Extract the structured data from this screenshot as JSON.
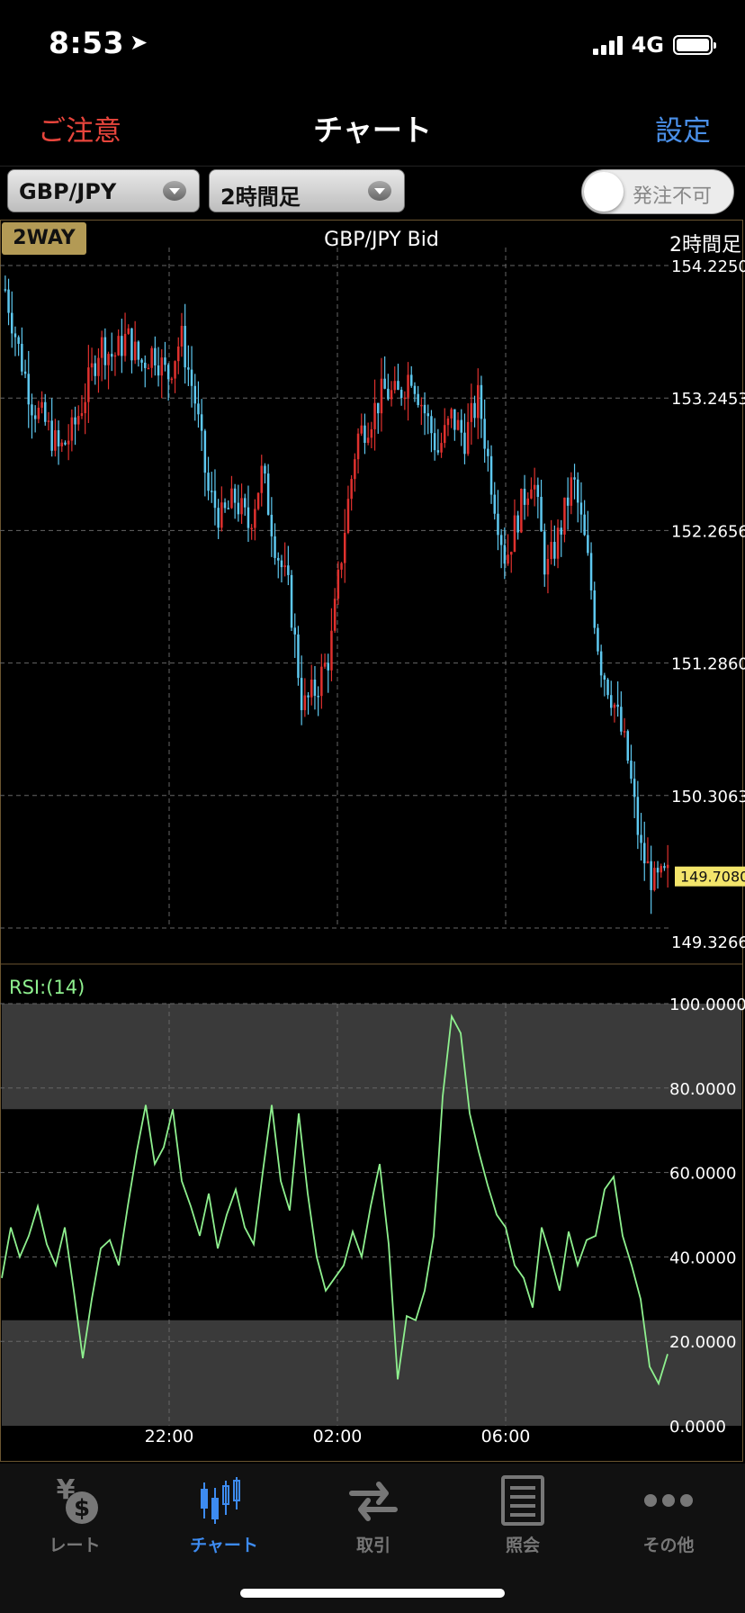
{
  "status": {
    "time": "8:53",
    "network": "4G"
  },
  "nav": {
    "caution": "ご注意",
    "title": "チャート",
    "settings": "設定"
  },
  "controls": {
    "pair": "GBP/JPY",
    "timeframe": "2時間足",
    "order_toggle": "発注不可"
  },
  "chart": {
    "mode_badge": "2WAY",
    "title": "GBP/JPY  Bid",
    "timeframe_label": "2時間足",
    "current_price": "149.7080",
    "rsi_label": "RSI:(14)",
    "colors": {
      "up": "#e0312e",
      "down": "#5ec8f0",
      "rsi": "#8ef08e",
      "price_tag": "#f3e56b",
      "panel_border": "#6b5530"
    }
  },
  "chart_data": [
    {
      "type": "candlestick",
      "title": "GBP/JPY  Bid",
      "price_ticks": [
        "154.2250",
        "153.2453",
        "152.2656",
        "151.2860",
        "150.3063",
        "149.3266"
      ],
      "x_ticks": [
        "22:00",
        "02:00",
        "06:00"
      ],
      "ylim": [
        149.3266,
        154.225
      ],
      "close_path": [
        154.05,
        153.6,
        153.2,
        153.05,
        152.85,
        153.0,
        153.3,
        153.65,
        153.55,
        153.7,
        153.5,
        153.6,
        153.4,
        153.7,
        153.25,
        152.55,
        152.35,
        152.5,
        152.3,
        152.7,
        152.15,
        151.8,
        150.95,
        151.1,
        151.35,
        152.2,
        152.95,
        153.1,
        153.3,
        153.25,
        153.45,
        153.15,
        152.85,
        153.1,
        152.95,
        153.25,
        152.6,
        152.05,
        152.4,
        152.7,
        151.95,
        152.25,
        152.65,
        152.1,
        151.3,
        151.0,
        150.6,
        149.9,
        149.65,
        149.71
      ],
      "last": 149.708
    },
    {
      "type": "line",
      "name": "RSI:(14)",
      "y_ticks": [
        "100.0000",
        "80.0000",
        "60.0000",
        "40.0000",
        "20.0000",
        "0.0000"
      ],
      "ylim": [
        0,
        100
      ],
      "overbought": 75,
      "oversold": 25,
      "values": [
        35,
        47,
        40,
        45,
        52,
        43,
        38,
        47,
        32,
        16,
        30,
        42,
        44,
        38,
        52,
        65,
        76,
        62,
        66,
        75,
        58,
        52,
        45,
        55,
        42,
        50,
        56,
        47,
        43,
        60,
        76,
        58,
        51,
        74,
        55,
        40,
        32,
        35,
        38,
        46,
        40,
        52,
        62,
        43,
        11,
        26,
        25,
        32,
        45,
        78,
        97,
        93,
        74,
        65,
        57,
        50,
        47,
        38,
        35,
        28,
        47,
        40,
        32,
        46,
        38,
        44,
        45,
        56,
        59,
        45,
        38,
        30,
        14,
        10,
        17
      ],
      "x_ticks": [
        "22:00",
        "02:00",
        "06:00"
      ]
    }
  ],
  "tabs": [
    {
      "label": "レート",
      "icon": "yen-dollar-icon"
    },
    {
      "label": "チャート",
      "icon": "candlestick-icon"
    },
    {
      "label": "取引",
      "icon": "swap-arrows-icon"
    },
    {
      "label": "照会",
      "icon": "list-document-icon"
    },
    {
      "label": "その他",
      "icon": "more-dots-icon"
    }
  ]
}
